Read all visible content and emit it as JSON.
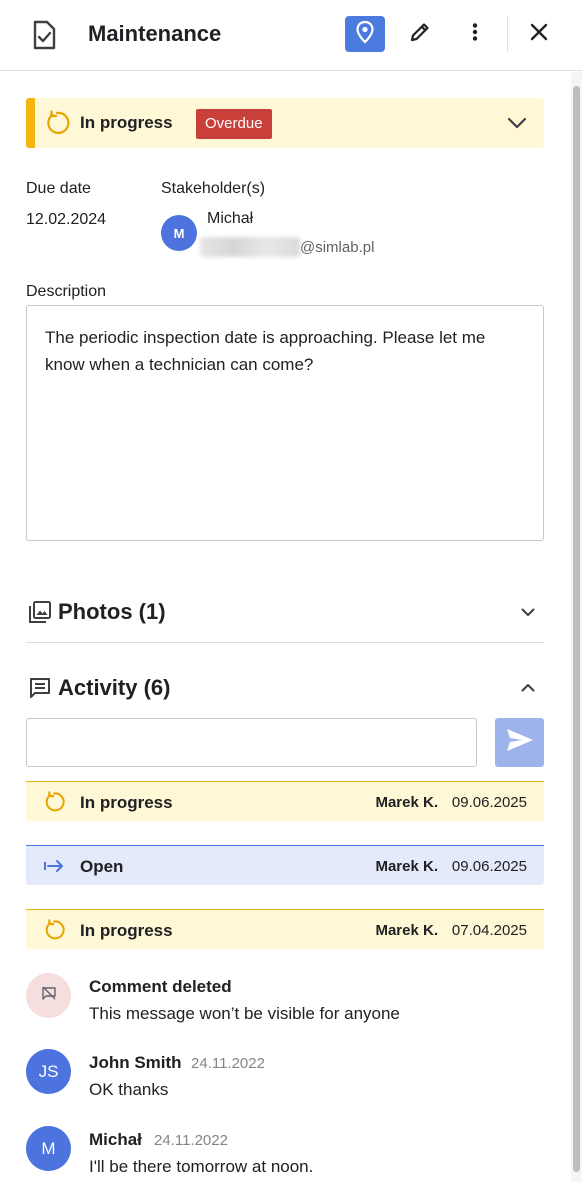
{
  "header": {
    "title": "Maintenance",
    "icons": [
      "task-document-icon",
      "location-pin-icon",
      "pencil-icon",
      "more-vertical-icon",
      "close-icon"
    ],
    "accent_color": "#4c7be0"
  },
  "status": {
    "label": "In progress",
    "badge": "Overdue",
    "colors": {
      "banner_bg": "#fff8d6",
      "banner_border": "#f6b40e",
      "badge_bg": "#c9403a"
    }
  },
  "due_date": {
    "label": "Due date",
    "value": "12.02.2024"
  },
  "stakeholders": {
    "label": "Stakeholder(s)",
    "items": [
      {
        "initial": "M",
        "name": "Michał",
        "email_domain": "@simlab.pl"
      }
    ]
  },
  "description": {
    "label": "Description",
    "text": "The periodic inspection date is approaching. Please let me know when a technician can come?"
  },
  "photos": {
    "title": "Photos (1)"
  },
  "activity": {
    "title": "Activity (6)",
    "comment_placeholder": "",
    "events": [
      {
        "type": "progress",
        "label": "In progress",
        "by": "Marek K.",
        "date": "09.06.2025"
      },
      {
        "type": "open",
        "label": "Open",
        "by": "Marek K.",
        "date": "09.06.2025"
      },
      {
        "type": "progress",
        "label": "In progress",
        "by": "Marek K.",
        "date": "07.04.2025"
      }
    ],
    "comments": [
      {
        "name": "Comment deleted",
        "date": "",
        "text": "This message won’t be visible for anyone"
      },
      {
        "initials": "JS",
        "name": "John Smith",
        "date": "24.11.2022",
        "text": "OK thanks"
      },
      {
        "initials": "M",
        "name": "Michał",
        "date": "24.11.2022",
        "text": "I'll be there tomorrow at noon."
      }
    ]
  }
}
